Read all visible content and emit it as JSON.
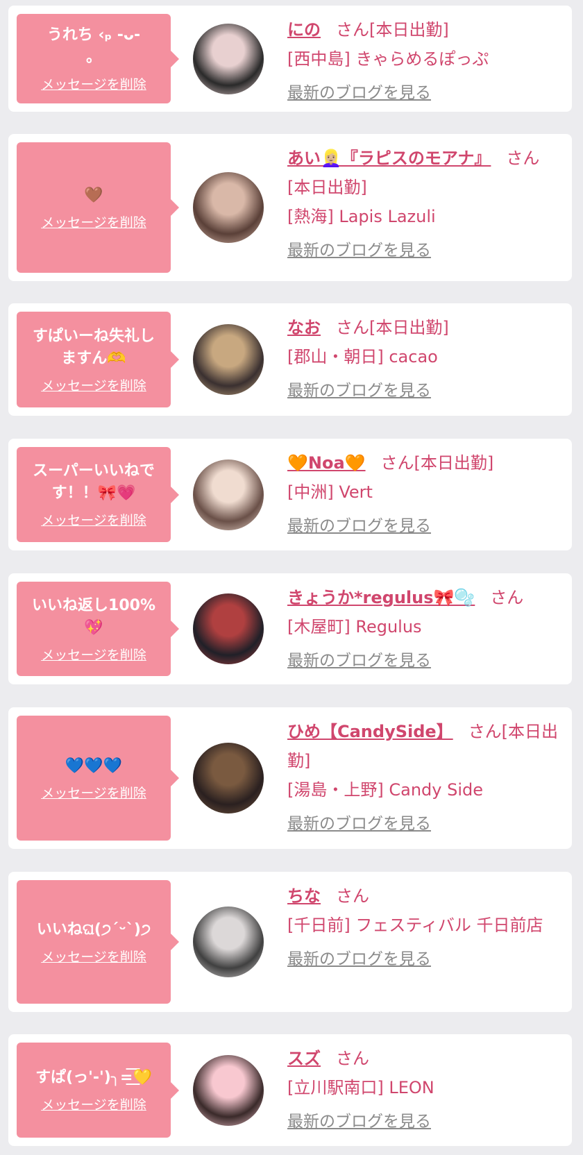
{
  "colors": {
    "accent": "#d0466d",
    "bubble": "#f4909f",
    "link_gray": "#8a8a8a",
    "background": "#ececef"
  },
  "delete_label": "メッセージを削除",
  "blog_label": "最新のブログを見る",
  "cards": [
    {
      "message": "うれち ‹ₚ -ᴗ-\n。",
      "name": "にの",
      "suffix": "さん[本日出勤]",
      "shop": "[西中島] きゃらめるぽっぷ",
      "avatar": {
        "icon": "avatar-photo",
        "colors": [
          "#e8d0d0",
          "#2a2a2a"
        ]
      }
    },
    {
      "message": "🤎",
      "name": "あい👱🏼‍♀️『ラピスのモアナ』",
      "suffix": "さん[本日出勤]",
      "shop": "[熱海] Lapis Lazuli",
      "avatar": {
        "icon": "avatar-photo",
        "colors": [
          "#d9b8a8",
          "#5a4038"
        ]
      }
    },
    {
      "message": "すぱいーね失礼し\nますん🫶",
      "name": "なお",
      "suffix": "さん[本日出勤]",
      "shop": "[郡山・朝日] cacao",
      "avatar": {
        "icon": "avatar-photo",
        "colors": [
          "#c8a880",
          "#3a3030"
        ]
      }
    },
    {
      "message": "スーパーいいねで\nす！！🎀💗",
      "name": "🧡Noa🧡",
      "suffix": "さん[本日出勤]",
      "shop": "[中洲] Vert",
      "avatar": {
        "icon": "avatar-photo",
        "colors": [
          "#f0dcd0",
          "#6a5048"
        ]
      }
    },
    {
      "message": "いいね返し100%\n💖",
      "name": "きょうか*regulus🎀🫧",
      "suffix": "さん",
      "shop": "[木屋町] Regulus",
      "avatar": {
        "icon": "avatar-photo",
        "colors": [
          "#b04040",
          "#202028"
        ]
      }
    },
    {
      "message": "💙💙💙",
      "name": "ひめ【CandySide】",
      "suffix": "さん[本日出勤]",
      "shop": "[湯島・上野] Candy Side",
      "avatar": {
        "icon": "avatar-photo",
        "colors": [
          "#7a5a40",
          "#2a2020"
        ]
      }
    },
    {
      "message": "いいねଘ(੭ˊᵕˋ)੭",
      "name": "ちな",
      "suffix": "さん",
      "shop": "[千日前] フェスティバル 千日前店",
      "avatar": {
        "icon": "avatar-photo",
        "colors": [
          "#dcd8d8",
          "#404040"
        ]
      }
    },
    {
      "message": "すぱ(っ'-')╮=͟͟͞͞💛",
      "name": "スズ",
      "suffix": "さん",
      "shop": "[立川駅南口] LEON",
      "avatar": {
        "icon": "avatar-photo",
        "colors": [
          "#f8c8d0",
          "#3a2a2a"
        ]
      }
    }
  ]
}
